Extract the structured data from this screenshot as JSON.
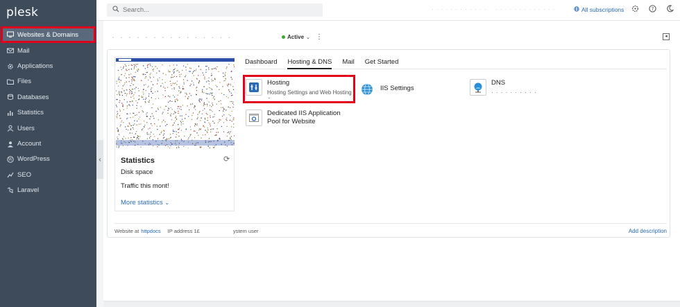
{
  "app": {
    "logo": "plesk"
  },
  "sidebar": {
    "items": [
      {
        "label": "Websites & Domains",
        "icon": "monitor-icon",
        "active": true
      },
      {
        "label": "Mail",
        "icon": "mail-icon"
      },
      {
        "label": "Applications",
        "icon": "gear-icon"
      },
      {
        "label": "Files",
        "icon": "folder-icon"
      },
      {
        "label": "Databases",
        "icon": "database-icon"
      },
      {
        "label": "Statistics",
        "icon": "bar-chart-icon"
      },
      {
        "label": "Users",
        "icon": "user-icon"
      },
      {
        "label": "Account",
        "icon": "account-icon"
      },
      {
        "label": "WordPress",
        "icon": "wordpress-icon"
      },
      {
        "label": "SEO",
        "icon": "seo-icon"
      },
      {
        "label": "Laravel",
        "icon": "laravel-icon"
      }
    ],
    "collapse": "‹"
  },
  "header": {
    "search_placeholder": "Search...",
    "blurred_1": "· · · · · · · · · · · ·",
    "blurred_2": "· · · · · · · · · · · · ·",
    "all_subscriptions": "All subscriptions"
  },
  "domain": {
    "title_blurred": "·  ·  ·  ·  ·  ·  ·  ·  ·  ·  ·  ·  ·  ·  ·",
    "status": "Active",
    "status_color": "#3ea635"
  },
  "tabs": [
    {
      "label": "Dashboard"
    },
    {
      "label": "Hosting & DNS",
      "active": true
    },
    {
      "label": "Mail"
    },
    {
      "label": "Get Started"
    }
  ],
  "tools": {
    "hosting": {
      "name": "Hosting",
      "desc": "Hosting Settings and Web Hosting Access"
    },
    "iis": {
      "name": "IIS Settings"
    },
    "dns": {
      "name": "DNS",
      "desc": "· · · · · · · · · ·"
    },
    "pool": {
      "name": "Dedicated IIS Application Pool for Website"
    }
  },
  "statistics": {
    "title": "Statistics",
    "disk_space": "Disk space",
    "traffic": "Traffic this mont!",
    "more": "More statistics"
  },
  "footer": {
    "website_at": "Website at",
    "httpdocs": "httpdocs",
    "ip_address": "IP address 1£",
    "system_user": "ystem user",
    "add_description": "Add description"
  },
  "colors": {
    "accent": "#2a6ab6",
    "sidebar": "#3e4b5b",
    "highlight": "#e3001b"
  }
}
